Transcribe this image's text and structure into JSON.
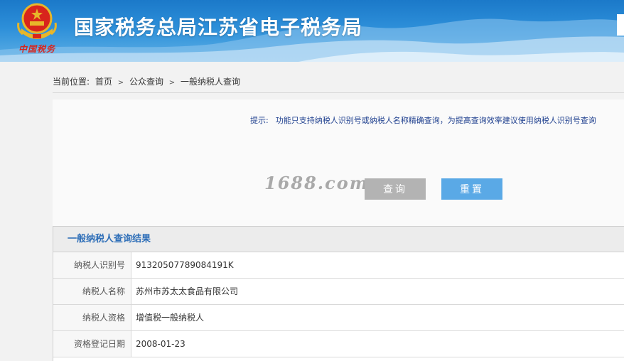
{
  "header": {
    "title": "国家税务总局江苏省电子税务局",
    "emblem_text": "中国税务",
    "colors": {
      "bar": "#2d8fd9",
      "emblem_red": "#d8241c",
      "emblem_gold": "#e7b62a"
    }
  },
  "breadcrumb": {
    "label": "当前位置:",
    "items": [
      "首页",
      "公众查询",
      "一般纳税人查询"
    ],
    "separator": ">"
  },
  "query": {
    "tip_label": "提示:",
    "tip_text": "功能只支持纳税人识别号或纳税人名称精确查询，为提高查询效率建议使用纳税人识别号查询",
    "watermark": "1688.com",
    "query_button": "查询",
    "reset_button": "重置"
  },
  "result": {
    "title": "一般纳税人查询结果",
    "rows": [
      {
        "label": "纳税人识别号",
        "value": "91320507789084191K"
      },
      {
        "label": "纳税人名称",
        "value": "苏州市苏太太食品有限公司"
      },
      {
        "label": "纳税人资格",
        "value": "增值税一般纳税人"
      },
      {
        "label": "资格登记日期",
        "value": "2008-01-23"
      }
    ]
  }
}
